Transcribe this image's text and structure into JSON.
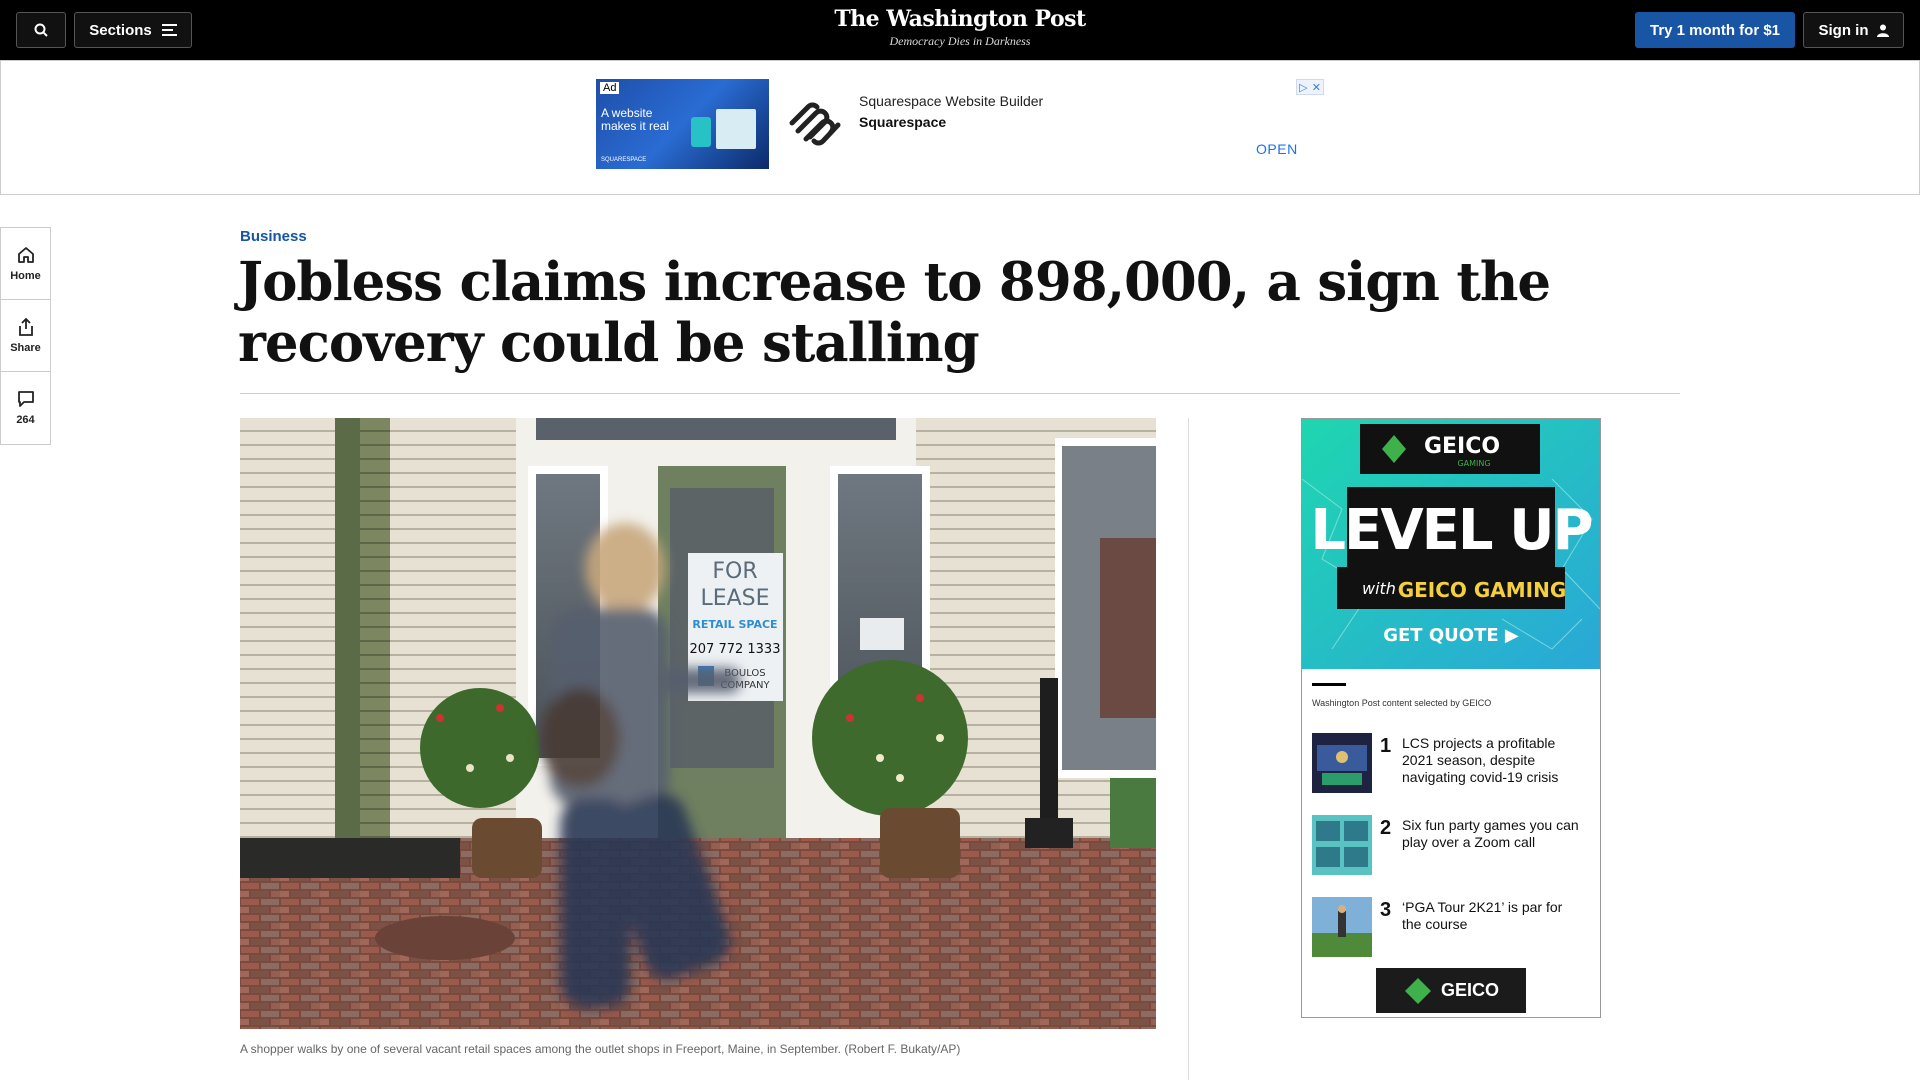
{
  "topbar": {
    "sections_label": "Sections",
    "logo": "The Washington Post",
    "tagline": "Democracy Dies in Darkness",
    "try_label": "Try 1 month for $1",
    "signin_label": "Sign in"
  },
  "ad_strip": {
    "badge": "Ad",
    "thumb_text": "A website makes it real",
    "thumb_brand": "SQUARESPACE",
    "title": "Squarespace Website Builder",
    "brand": "Squarespace",
    "cta": "OPEN"
  },
  "rail": {
    "home": "Home",
    "share": "Share",
    "comments_count": "264"
  },
  "article": {
    "kicker": "Business",
    "headline": "Jobless claims increase to 898,000, a sign the recovery could be stalling",
    "caption": "A shopper walks by one of several vacant retail spaces among the outlet shops in Freeport, Maine, in September. (Robert F. Bukaty/AP)",
    "sign": {
      "line1": "FOR",
      "line2": "LEASE",
      "line3": "RETAIL SPACE",
      "phone": "207 772 1333",
      "company_1": "BOULOS",
      "company_2": "COMPANY"
    }
  },
  "side_ad": {
    "brand": "GEICO",
    "sub": "GAMING",
    "headline_1": "LEVEL UP",
    "with": "with",
    "headline_2": "GEICO GAMING",
    "cta": "GET QUOTE ▶",
    "selected_by": "Washington Post content selected by GEICO",
    "items": [
      {
        "num": "1",
        "text": "LCS projects a profitable 2021 season, despite navigating covid-19 crisis"
      },
      {
        "num": "2",
        "text": "Six fun party games you can play over a Zoom call"
      },
      {
        "num": "3",
        "text": "‘PGA Tour 2K21’ is par for the course"
      }
    ]
  }
}
